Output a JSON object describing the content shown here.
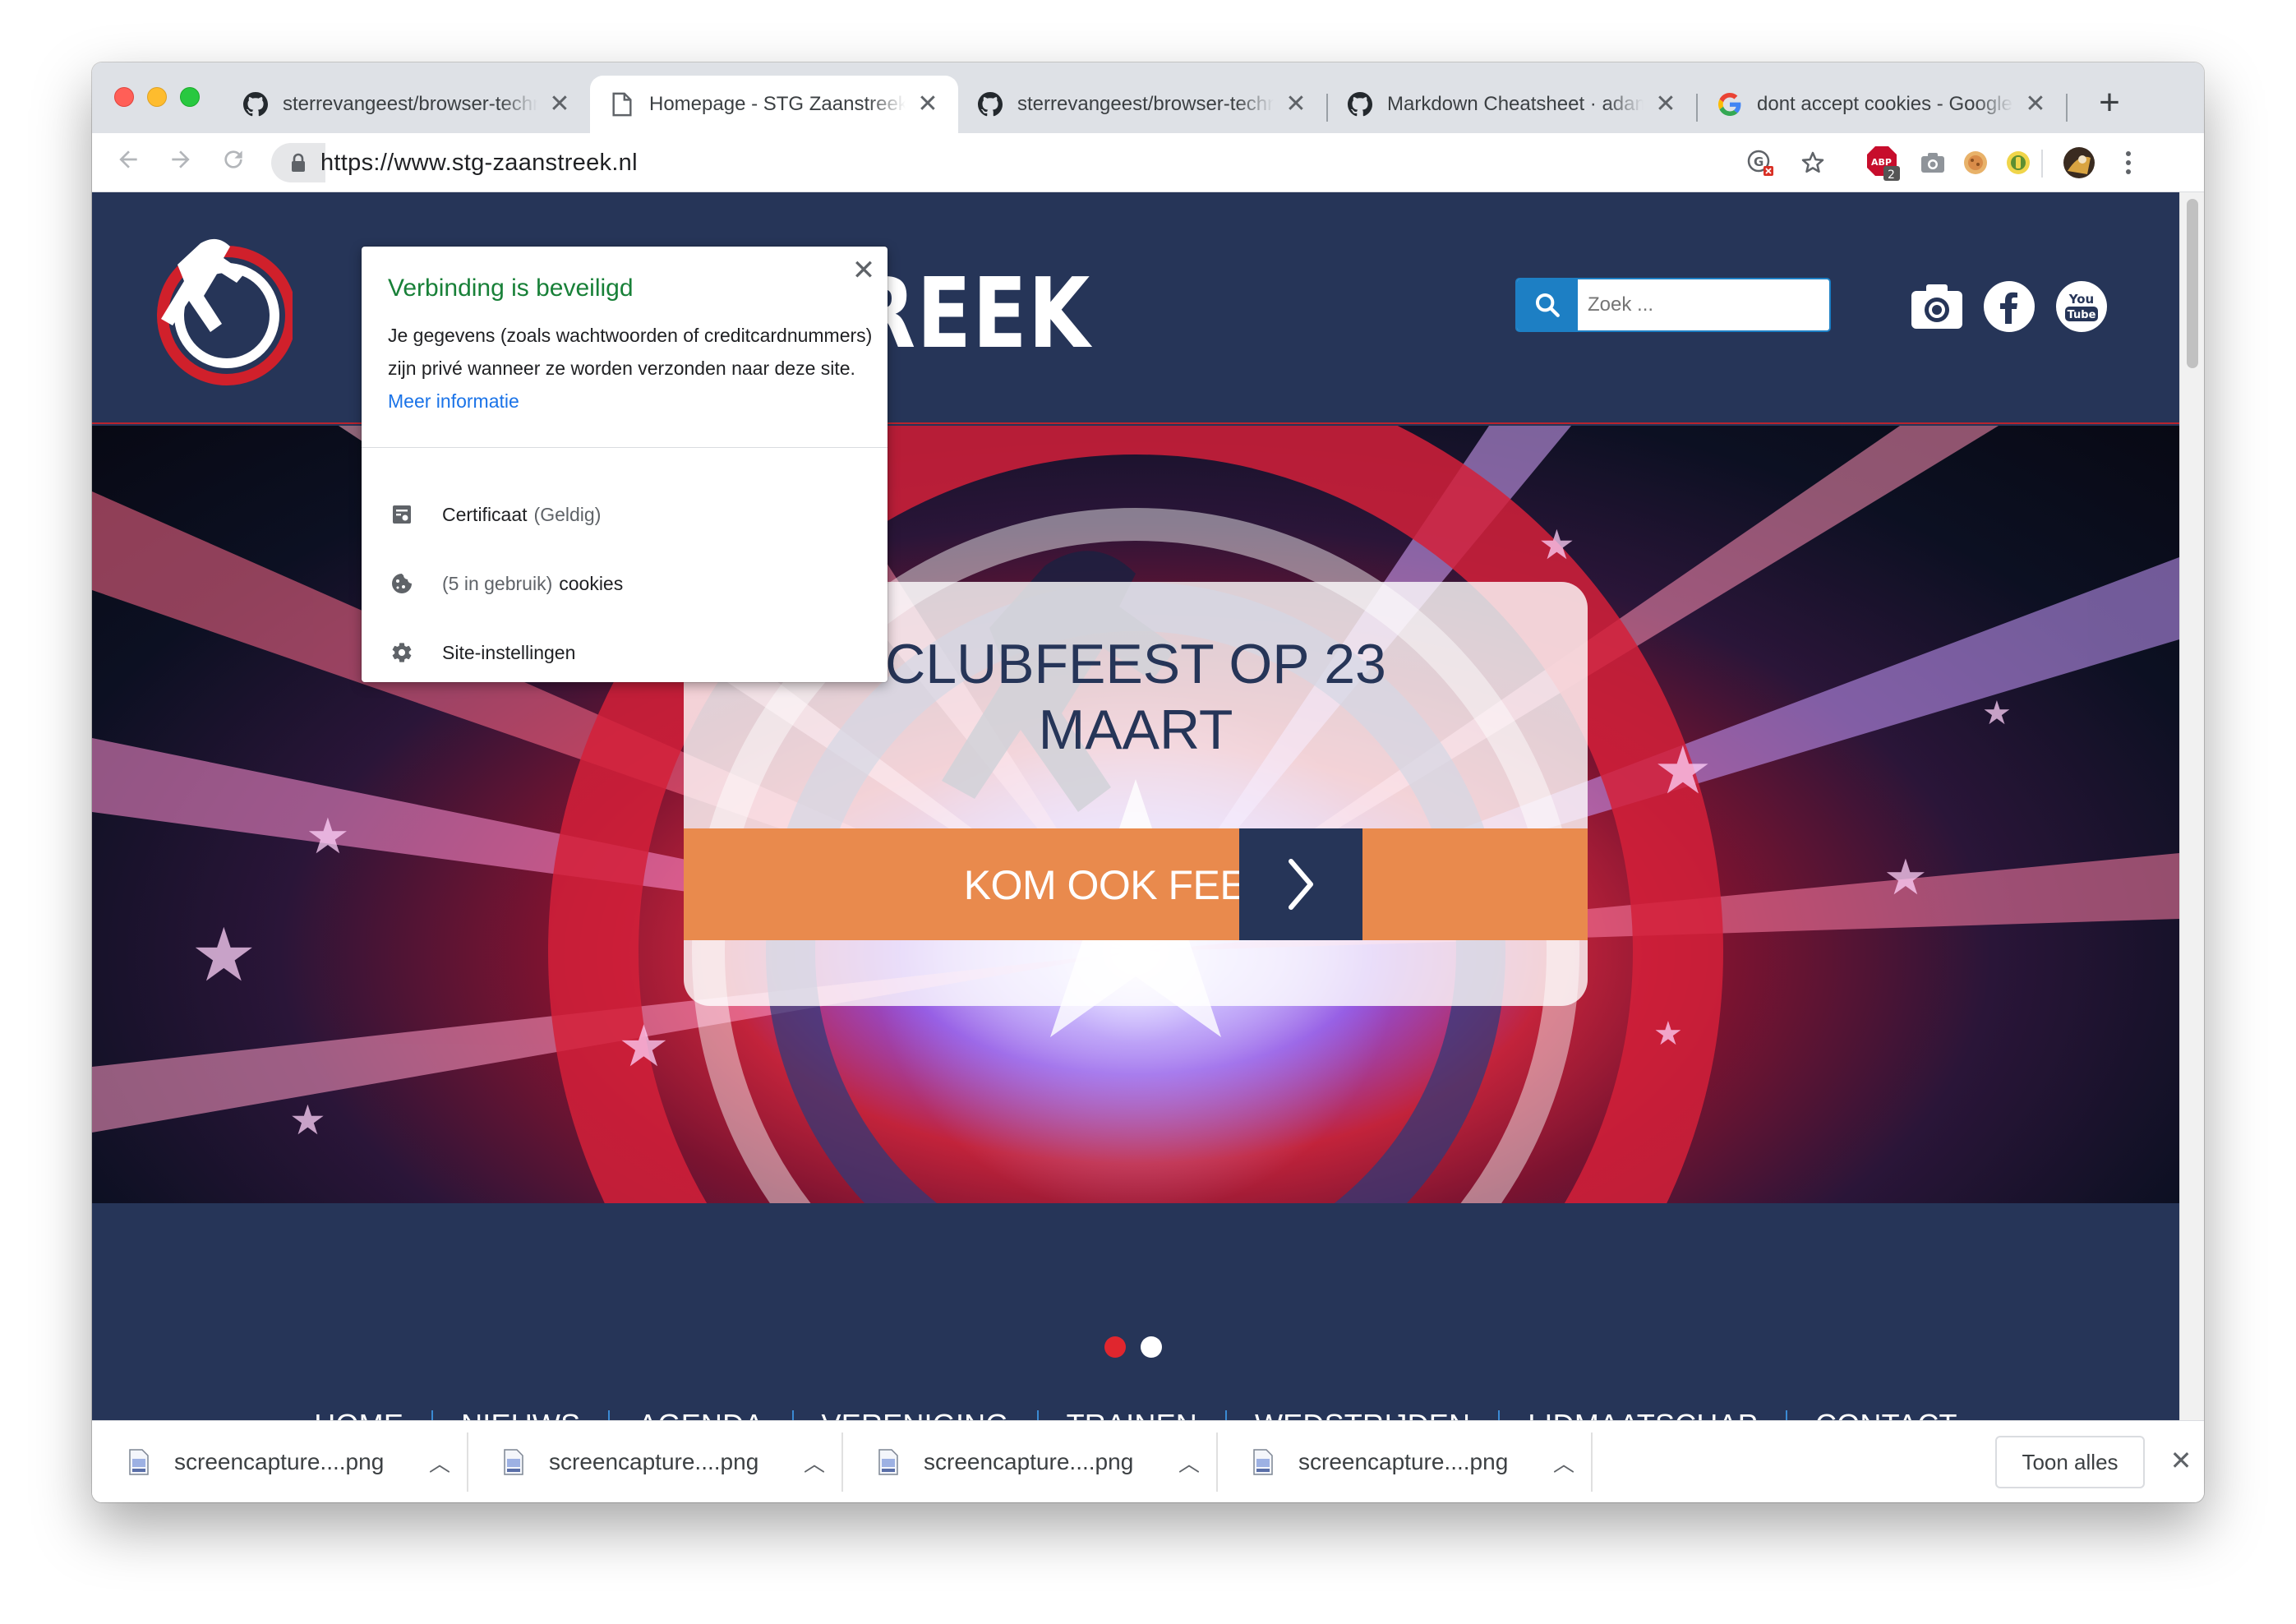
{
  "tabs": [
    {
      "title": "sterrevangeest/browser-technologies",
      "icon": "github-icon",
      "active": false
    },
    {
      "title": "Homepage - STG Zaanstreek",
      "icon": "page-icon",
      "active": true
    },
    {
      "title": "sterrevangeest/browser-technologies",
      "icon": "github-icon",
      "active": false
    },
    {
      "title": "Markdown Cheatsheet · adam-p/markdown-here",
      "icon": "github-icon",
      "active": false
    },
    {
      "title": "dont accept cookies - Google Search",
      "icon": "google-icon",
      "active": false
    }
  ],
  "tab_close": "✕",
  "new_tab": "+",
  "address": {
    "url": "https://www.stg-zaanstreek.nl"
  },
  "toolbar": {
    "adblock_badge": "2",
    "adblock_label": "ABP"
  },
  "site": {
    "brand_partial": "TREEK",
    "search_placeholder": "Zoek ...",
    "social": [
      "camera-icon",
      "facebook-icon",
      "youtube-icon"
    ],
    "youtube_label_top": "You",
    "youtube_label_bottom": "Tube"
  },
  "hero": {
    "title_line1": "CLUBFEEST OP 23",
    "title_line2": "MAART",
    "cta": "KOM OOK FEESTEN!",
    "slides": 2,
    "active_slide": 1
  },
  "nav": [
    "HOME",
    "NIEUWS",
    "AGENDA",
    "VERENIGING",
    "TRAINEN",
    "WEDSTRIJDEN",
    "LIDMAATSCHAP",
    "CONTACT"
  ],
  "popup": {
    "title": "Verbinding is beveiligd",
    "description": "Je gegevens (zoals wachtwoorden of creditcardnummers) zijn privé wanneer ze worden verzonden naar deze site.",
    "more_link": "Meer informatie",
    "certificate": "Certificaat",
    "certificate_status": "(Geldig)",
    "cookies_count": "(5 in gebruik)",
    "cookies": "cookies",
    "site_settings": "Site-instellingen",
    "close": "✕"
  },
  "downloads": {
    "items": [
      "screencapture....png",
      "screencapture....png",
      "screencapture....png",
      "screencapture....png"
    ],
    "show_all": "Toon alles",
    "close": "✕"
  },
  "colors": {
    "navy": "#263558",
    "orange": "#e98a4d",
    "secure_green": "#188038",
    "link_blue": "#1a73e8",
    "search_blue": "#1d7fc4",
    "dot_active": "#e0262e"
  }
}
